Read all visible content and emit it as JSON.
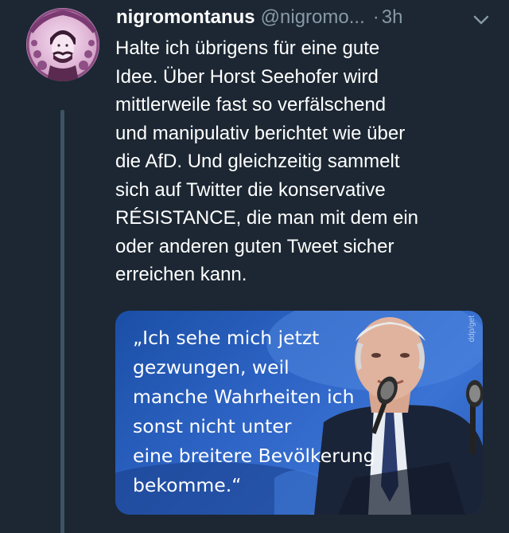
{
  "tweet": {
    "display_name": "nigromontanus",
    "handle": "@nigromo...",
    "separator": "·",
    "time": "3h",
    "text_lines": [
      "Halte ich übrigens für eine gute",
      "Idee. Über Horst Seehofer wird",
      "mittlerweile fast so verfälschend",
      "und manipulativ berichtet wie über",
      "die AfD. Und gleichzeitig sammelt",
      "sich auf Twitter die konservative",
      "RÉSISTANCE, die man mit dem ein",
      "oder anderen guten Tweet sicher",
      "erreichen kann."
    ],
    "media": {
      "quote_lines": [
        "„Ich sehe mich jetzt",
        "gezwungen, weil",
        "manche Wahrheiten ich",
        "sonst nicht unter",
        "eine breitere Bevölkerung",
        "bekomme.“"
      ],
      "watermark": "ddp/get"
    }
  },
  "icons": {
    "more": "chevron-down-icon",
    "avatar": "avatar-portrait"
  },
  "colors": {
    "background": "#1c2733",
    "text": "#ffffff",
    "secondary": "#8899a6",
    "thread_line": "#3d5466",
    "media_blue": "#2d63c4"
  }
}
